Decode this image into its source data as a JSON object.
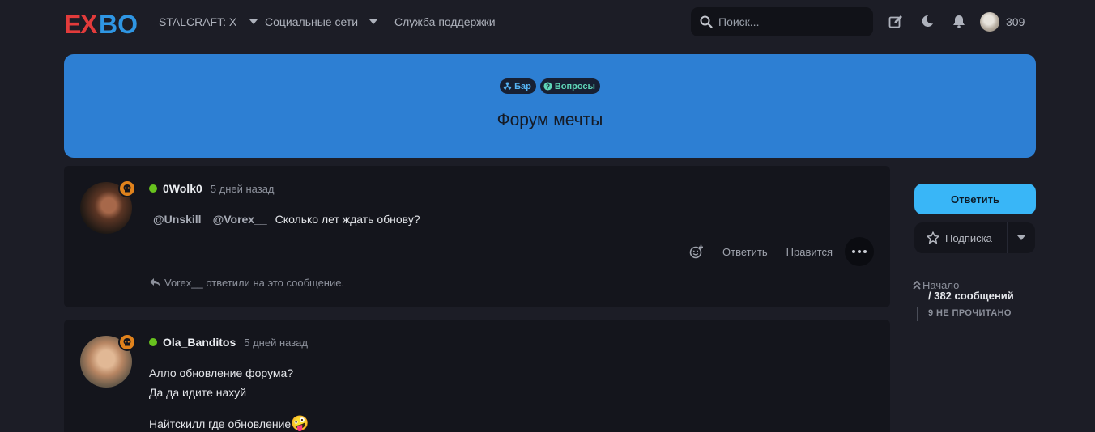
{
  "header": {
    "logo_text": "EXBO",
    "nav": [
      {
        "label": "STALCRAFT: X",
        "has_dropdown": true
      },
      {
        "label": "Социальные сети",
        "has_dropdown": true
      },
      {
        "label": "Служба поддержки",
        "has_dropdown": false
      }
    ],
    "search_placeholder": "Поиск...",
    "icons": [
      "edit-icon",
      "moon-icon",
      "bell-icon"
    ],
    "user_count": "309"
  },
  "banner": {
    "tags": [
      {
        "label": "Бар",
        "icon": "radiation-icon"
      },
      {
        "label": "Вопросы",
        "icon": "question-icon"
      }
    ],
    "title": "Форум мечты",
    "color": "#2d7fd3"
  },
  "posts": [
    {
      "author": "0Wolk0",
      "time": "5 дней назад",
      "mentions": [
        "@Unskill",
        "@Vorex__"
      ],
      "text": "Сколько лет ждать обнову?",
      "actions": {
        "reply": "Ответить",
        "like": "Нравится"
      },
      "replied_note": "Vorex__ ответили на это сообщение."
    },
    {
      "author": "Ola_Banditos",
      "time": "5 дней назад",
      "lines": [
        "Алло обновление форума?",
        "Да да идите нахуй",
        "Найтскилл где обновление"
      ],
      "emoji": "🤪"
    }
  ],
  "sidebar": {
    "reply_label": "Ответить",
    "subscribe_label": "Подписка",
    "start_label": "Начало",
    "message_count": "/ 382 сообщений",
    "unread": "9 НЕ ПРОЧИТАНО",
    "accent": "#39b6f7"
  }
}
